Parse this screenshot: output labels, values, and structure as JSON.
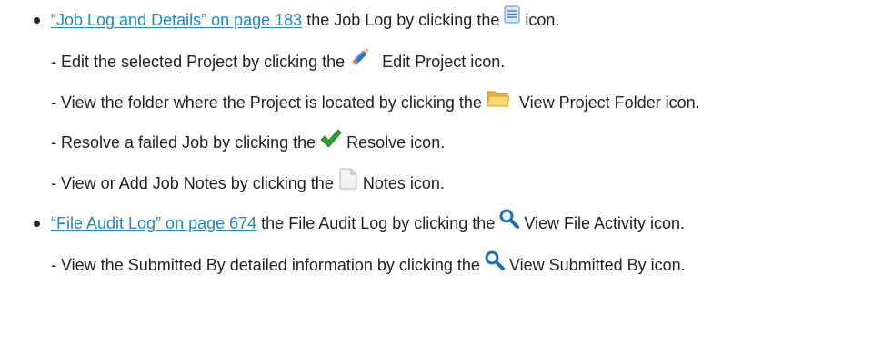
{
  "items": [
    {
      "link": "“Job Log and Details” on page 183",
      "before": " the Job Log by clicking the ",
      "icon": "job-log-icon",
      "after": " icon."
    },
    {
      "text_before": "- Edit the selected Project by clicking the ",
      "icon": "pencil-icon",
      "text_after": "Edit Project icon."
    },
    {
      "text_before": "- View the folder where the Project is located by clicking the ",
      "icon": "folder-icon",
      "text_after": "View Project Folder icon."
    },
    {
      "text_before": "- Resolve a failed Job by clicking the ",
      "icon": "checkmark-icon",
      "text_after": "Resolve icon."
    },
    {
      "text_before": "- View or Add Job Notes by clicking the ",
      "icon": "notes-icon",
      "text_after": "Notes icon."
    },
    {
      "link": "“File Audit Log” on page 674",
      "before": " the File Audit Log by clicking the ",
      "icon": "magnifier-icon",
      "after": "View File Activity icon."
    },
    {
      "text_before": "- View the Submitted By detailed information by clicking the ",
      "icon": "magnifier-icon",
      "text_after": "View Submitted By icon."
    }
  ],
  "colors": {
    "link": "#1e88c7",
    "text": "#222222",
    "check": "#2e9e2e",
    "folder": "#f2c94c",
    "magnifier": "#1a6fc0"
  }
}
